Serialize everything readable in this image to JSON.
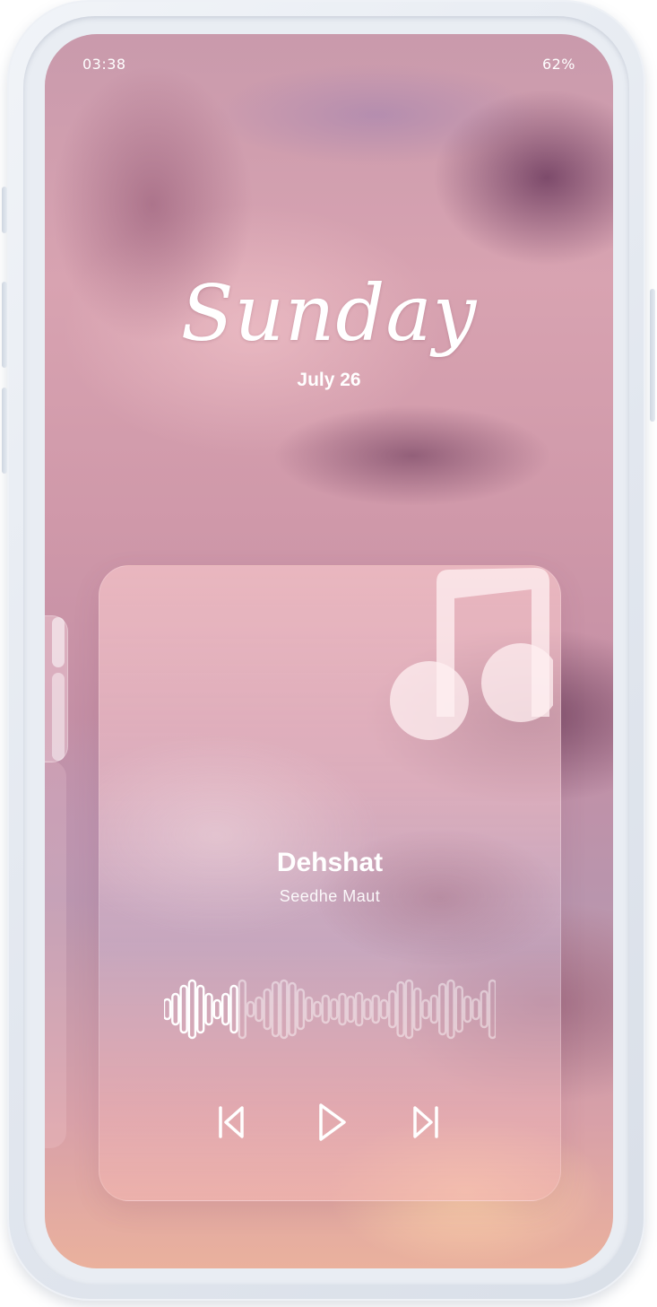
{
  "status_bar": {
    "time": "03:38",
    "battery": "62%"
  },
  "lock_screen": {
    "day": "Sunday",
    "date": "July 26"
  },
  "player": {
    "song_title": "Dehshat",
    "artist": "Seedhe Maut",
    "progress": 0.23,
    "icons": {
      "artwork": "music-note-icon",
      "previous": "skip-previous-icon",
      "play": "play-icon",
      "next": "skip-next-icon"
    },
    "waveform_bars": [
      22,
      34,
      52,
      64,
      52,
      34,
      20,
      34,
      52,
      64,
      16,
      26,
      44,
      60,
      64,
      58,
      44,
      26,
      16,
      30,
      22,
      34,
      28,
      36,
      22,
      30,
      20,
      40,
      60,
      64,
      46,
      20,
      30,
      56,
      64,
      50,
      28,
      22,
      40,
      64
    ]
  },
  "colors": {
    "text": "#ffffff",
    "waveform_played": "#ffffff",
    "waveform_unplayed": "rgba(255,255,255,0.45)"
  }
}
